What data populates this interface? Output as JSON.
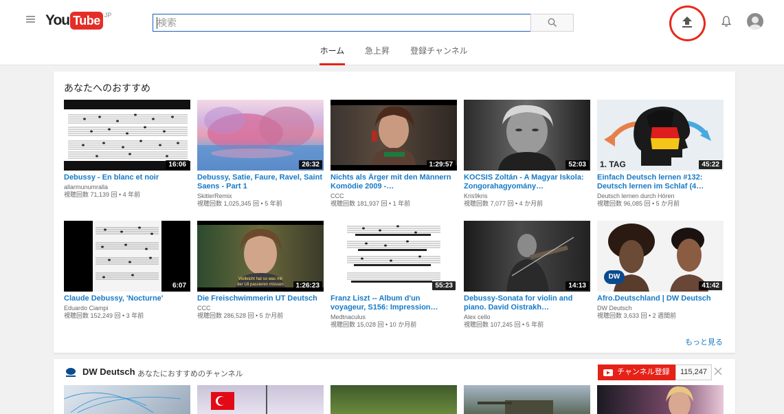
{
  "masthead": {
    "menu_icon": "hamburger-menu-icon",
    "logo": {
      "you": "You",
      "tube": "Tube",
      "region": "JP"
    },
    "search": {
      "placeholder": "検索",
      "value": "",
      "button_icon": "search-icon"
    },
    "upload_icon": "upload-icon",
    "notifications_icon": "bell-icon",
    "avatar_icon": "avatar-icon"
  },
  "tabs": [
    {
      "label": "ホーム",
      "active": true
    },
    {
      "label": "急上昇",
      "active": false
    },
    {
      "label": "登録チャンネル",
      "active": false
    }
  ],
  "recommended": {
    "title": "あなたへのおすすめ",
    "more_label": "もっと見る",
    "videos": [
      {
        "title": "Debussy - En blanc et noir",
        "channel": "allarmunumralla",
        "meta": "視聴回数 71,139 回 • 4 年前",
        "duration": "16:06"
      },
      {
        "title": "Debussy, Satie, Faure, Ravel, Saint Saens - Part 1",
        "channel": "SkitlerRemix",
        "meta": "視聴回数 1,025,345 回 • 5 年前",
        "duration": "26:32"
      },
      {
        "title": "Nichts als Ärger mit den Männern Komödie 2009 -…",
        "channel": "CCC",
        "meta": "視聴回数 181,937 回 • 1 年前",
        "duration": "1:29:57"
      },
      {
        "title": "KOCSIS Zoltán - A Magyar Iskola: Zongorahagyomány…",
        "channel": "Kris9kris",
        "meta": "視聴回数 7,077 回 • 4 か月前",
        "duration": "52:03"
      },
      {
        "title": "Einfach Deutsch lernen #132: Deutsch lernen im Schlaf (4…",
        "channel": "Deutsch lernen durch Hören",
        "meta": "視聴回数 96,085 回 • 5 か月前",
        "duration": "45:22",
        "thumb_text": "1. TAG"
      },
      {
        "title": "Claude Debussy, 'Nocturne'",
        "channel": "Eduardo Ciampi",
        "meta": "視聴回数 152,249 回 • 3 年前",
        "duration": "6:07"
      },
      {
        "title": "Die Freischwimmerin UT Deutsch",
        "channel": "CCC",
        "meta": "視聴回数 286,528 回 • 5 か月前",
        "duration": "1:26:23",
        "thumb_caption": [
          "Vielleicht hat so was mit",
          "der Uil passieren müssen."
        ]
      },
      {
        "title": "Franz Liszt -- Album d'un voyageur, S156: Impression…",
        "channel": "Medtnaculus",
        "meta": "視聴回数 15,028 回 • 10 か月前",
        "duration": "55:23"
      },
      {
        "title": "Debussy-Sonata for violin and piano. David Oistrakh…",
        "channel": "Alex cello",
        "meta": "視聴回数 107,245 回 • 5 年前",
        "duration": "14:13"
      },
      {
        "title": "Afro.Deutschland | DW Deutsch",
        "channel": "DW Deutsch",
        "meta": "視聴回数 3,633 回 • 2 週間前",
        "duration": "41:42",
        "thumb_logo": "DW"
      }
    ]
  },
  "shelf": {
    "channel_name": "DW Deutsch",
    "subtitle": "あなたにおすすめのチャンネル",
    "subscribe_label": "チャンネル登録",
    "subscriber_count": "115,247",
    "close_icon": "close-icon"
  },
  "colors": {
    "brand_red": "#e62117",
    "link_blue": "#167ac6",
    "search_border": "#1c62b9",
    "annotation_red": "#e8291c"
  }
}
